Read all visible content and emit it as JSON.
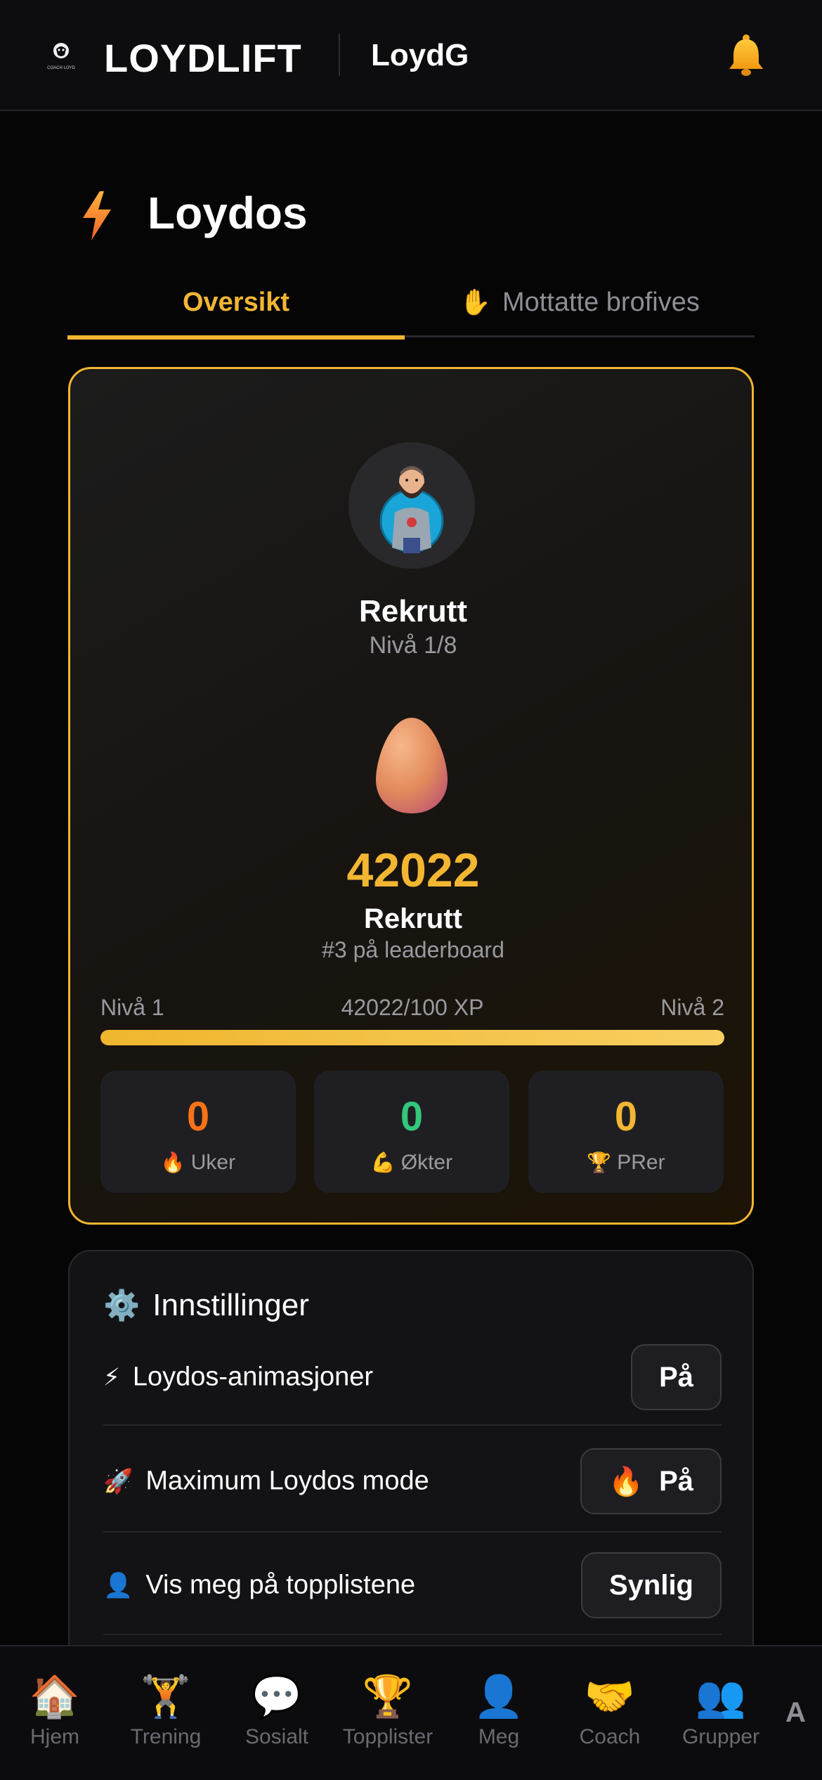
{
  "header": {
    "brand": "LOYDLIFT",
    "logo_text": "COACH LOYD",
    "username": "LoydG",
    "logo_icon": "coach-loyd-logo",
    "bell_icon": "bell-icon"
  },
  "page": {
    "title": "Loydos",
    "title_icon": "bolt-icon"
  },
  "tabs": [
    {
      "label": "Oversikt",
      "icon": "",
      "active": true
    },
    {
      "label": "Mottatte brofives",
      "icon": "✋",
      "active": false
    }
  ],
  "overview": {
    "avatar_icon": "coach-avatar",
    "rank": "Rekrutt",
    "level": "Nivå 1/8",
    "egg_icon": "egg-icon",
    "xp": "42022",
    "rank_again": "Rekrutt",
    "leaderboard": "#3 på leaderboard",
    "progress": {
      "left_label": "Nivå 1",
      "center_label": "42022/100 XP",
      "right_label": "Nivå 2",
      "fraction": 1.0
    },
    "stats": [
      {
        "value": "0",
        "icon": "🔥",
        "label": "Uker",
        "color": "#f97316"
      },
      {
        "value": "0",
        "icon": "💪",
        "label": "Økter",
        "color": "#34c77b"
      },
      {
        "value": "0",
        "icon": "🏆",
        "label": "PRer",
        "color": "#f2b632"
      }
    ]
  },
  "settings": {
    "title": "Innstillinger",
    "title_icon": "⚙️",
    "rows": [
      {
        "icon": "⚡",
        "label": "Loydos-animasjoner",
        "button_icon": "",
        "button": "På"
      },
      {
        "icon": "🚀",
        "label": "Maximum Loydos mode",
        "button_icon": "🔥",
        "button": "På"
      },
      {
        "icon": "👤",
        "label": "Vis meg på topplistene",
        "button_icon": "",
        "button": "Synlig"
      }
    ]
  },
  "nav": [
    {
      "icon": "🏠",
      "label": "Hjem"
    },
    {
      "icon": "🏋️",
      "label": "Trening"
    },
    {
      "icon": "💬",
      "label": "Sosialt"
    },
    {
      "icon": "🏆",
      "label": "Topplister"
    },
    {
      "icon": "👤",
      "label": "Meg"
    },
    {
      "icon": "🤝",
      "label": "Coach"
    },
    {
      "icon": "👥",
      "label": "Grupper"
    }
  ],
  "nav_extra": "A",
  "colors": {
    "accent": "#f2b632",
    "background": "#050506",
    "card": "#131315"
  }
}
